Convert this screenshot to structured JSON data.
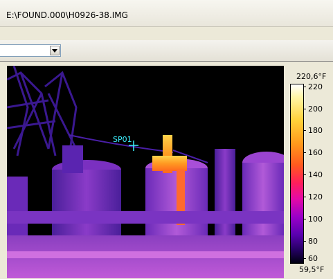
{
  "window": {
    "title": "E:\\FOUND.000\\H0926-38.IMG"
  },
  "toolbar": {
    "combo_value": ""
  },
  "thermal": {
    "spot_label": "SP01"
  },
  "palette": {
    "max_label": "220,6°F",
    "min_label": "59,5°F",
    "ticks": [
      "220",
      "200",
      "180",
      "160",
      "140",
      "120",
      "100",
      "80",
      "60"
    ]
  },
  "colors": {
    "spot_marker": "#3cf0ff",
    "background": "#000000"
  }
}
